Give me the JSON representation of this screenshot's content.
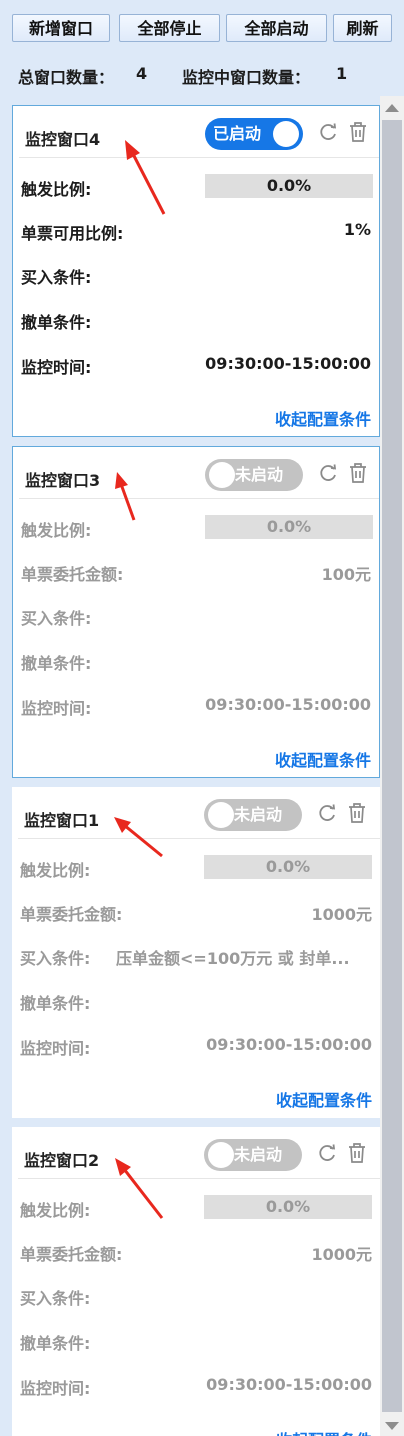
{
  "toolbar": {
    "add_window": "新增窗口",
    "stop_all": "全部停止",
    "start_all": "全部启动",
    "refresh": "刷新"
  },
  "summary": {
    "total_label": "总窗口数量：",
    "total_value": "4",
    "monitoring_label": "监控中窗口数量：",
    "monitoring_value": "1"
  },
  "cards": [
    {
      "title": "监控窗口4",
      "toggle": "已启动",
      "state": "on",
      "trigger_label": "触发比例:",
      "trigger_value": "0.0%",
      "amount_label": "单票可用比例:",
      "amount_value": "1%",
      "buy_label": "买入条件:",
      "buy_value": "",
      "cancel_label": "撤单条件:",
      "time_label": "监控时间:",
      "time_value": "09:30:00-15:00:00",
      "collapse": "收起配置条件"
    },
    {
      "title": "监控窗口3",
      "toggle": "未启动",
      "state": "off",
      "trigger_label": "触发比例:",
      "trigger_value": "0.0%",
      "amount_label": "单票委托金额:",
      "amount_value": "100元",
      "buy_label": "买入条件:",
      "buy_value": "",
      "cancel_label": "撤单条件:",
      "time_label": "监控时间:",
      "time_value": "09:30:00-15:00:00",
      "collapse": "收起配置条件"
    },
    {
      "title": "监控窗口1",
      "toggle": "未启动",
      "state": "off",
      "trigger_label": "触发比例:",
      "trigger_value": "0.0%",
      "amount_label": "单票委托金额:",
      "amount_value": "1000元",
      "buy_label": "买入条件:",
      "buy_value": "压单金额<=100万元 或 封单...",
      "cancel_label": "撤单条件:",
      "time_label": "监控时间:",
      "time_value": "09:30:00-15:00:00",
      "collapse": "收起配置条件"
    },
    {
      "title": "监控窗口2",
      "toggle": "未启动",
      "state": "off",
      "trigger_label": "触发比例:",
      "trigger_value": "0.0%",
      "amount_label": "单票委托金额:",
      "amount_value": "1000元",
      "buy_label": "买入条件:",
      "buy_value": "",
      "cancel_label": "撤单条件:",
      "time_label": "监控时间:",
      "time_value": "09:30:00-15:00:00",
      "collapse": "收起配置条件"
    }
  ],
  "colors": {
    "accent": "#1677e6",
    "annotation_arrow": "#e8281e"
  },
  "icons": {
    "refresh": "refresh-icon",
    "delete": "trash-icon"
  }
}
